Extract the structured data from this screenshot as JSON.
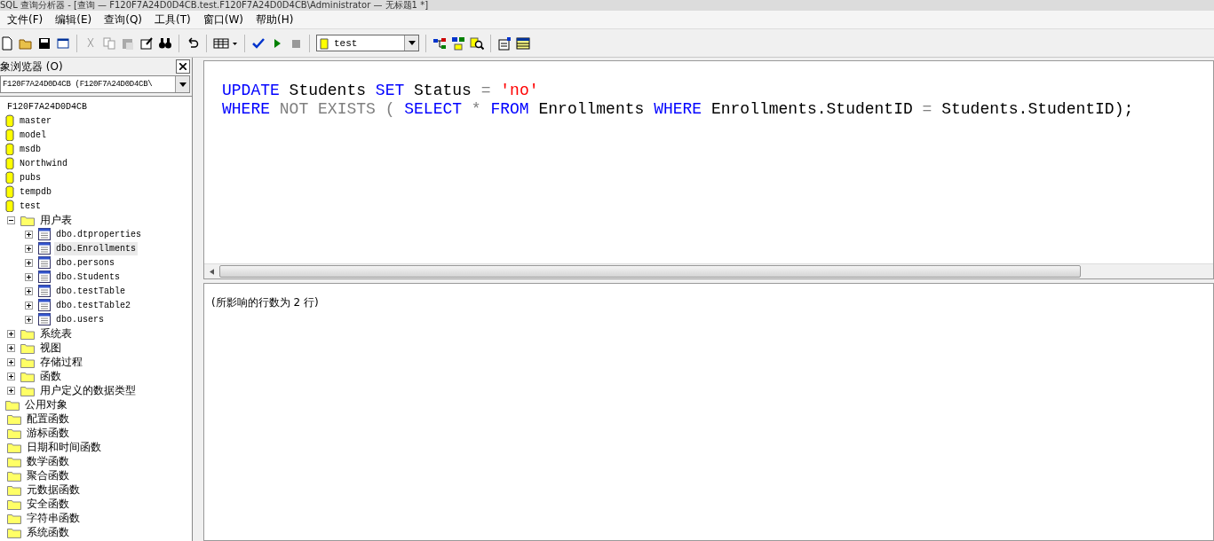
{
  "window": {
    "title": "SQL 查询分析器 - [查询 — F120F7A24D0D4CB.test.F120F7A24D0D4CB\\Administrator — 无标题1 *]"
  },
  "menu": [
    {
      "label": "文件(F)"
    },
    {
      "label": "编辑(E)"
    },
    {
      "label": "查询(Q)"
    },
    {
      "label": "工具(T)"
    },
    {
      "label": "窗口(W)"
    },
    {
      "label": "帮助(H)"
    }
  ],
  "toolbar": {
    "database": "test"
  },
  "object_browser": {
    "title": "象浏览器 (O)",
    "server_select": "F120F7A24D0D4CB (F120F7A24D0D4CB\\",
    "tree": [
      {
        "label": "F120F7A24D0D4CB",
        "children": [
          {
            "label": "master",
            "kind": "database"
          },
          {
            "label": "model",
            "kind": "database"
          },
          {
            "label": "msdb",
            "kind": "database"
          },
          {
            "label": "Northwind",
            "kind": "database"
          },
          {
            "label": "pubs",
            "kind": "database"
          },
          {
            "label": "tempdb",
            "kind": "database"
          },
          {
            "label": "test",
            "kind": "database",
            "children": [
              {
                "label": "用户表",
                "kind": "folder",
                "expanded": true,
                "children": [
                  {
                    "label": "dbo.dtproperties",
                    "kind": "table",
                    "expanded": false,
                    "selected": false
                  },
                  {
                    "label": "dbo.Enrollments",
                    "kind": "table",
                    "expanded": false,
                    "selected": true
                  },
                  {
                    "label": "dbo.persons",
                    "kind": "table",
                    "expanded": false,
                    "selected": false
                  },
                  {
                    "label": "dbo.Students",
                    "kind": "table",
                    "expanded": false,
                    "selected": false
                  },
                  {
                    "label": "dbo.testTable",
                    "kind": "table",
                    "expanded": false,
                    "selected": false
                  },
                  {
                    "label": "dbo.testTable2",
                    "kind": "table",
                    "expanded": false,
                    "selected": false
                  },
                  {
                    "label": "dbo.users",
                    "kind": "table",
                    "expanded": false,
                    "selected": false
                  }
                ]
              },
              {
                "label": "系统表",
                "kind": "folder",
                "expanded": false
              },
              {
                "label": "视图",
                "kind": "folder",
                "expanded": false
              },
              {
                "label": "存储过程",
                "kind": "folder",
                "expanded": false
              },
              {
                "label": "函数",
                "kind": "folder",
                "expanded": false
              },
              {
                "label": "用户定义的数据类型",
                "kind": "folder",
                "expanded": false
              }
            ]
          },
          {
            "label": "公用对象",
            "kind": "folder",
            "children": [
              {
                "label": "配置函数",
                "kind": "folder"
              },
              {
                "label": "游标函数",
                "kind": "folder"
              },
              {
                "label": "日期和时间函数",
                "kind": "folder"
              },
              {
                "label": "数学函数",
                "kind": "folder"
              },
              {
                "label": "聚合函数",
                "kind": "folder"
              },
              {
                "label": "元数据函数",
                "kind": "folder"
              },
              {
                "label": "安全函数",
                "kind": "folder"
              },
              {
                "label": "字符串函数",
                "kind": "folder"
              },
              {
                "label": "系统函数",
                "kind": "folder"
              }
            ]
          }
        ]
      }
    ]
  },
  "editor": {
    "lines": [
      [
        {
          "text": "UPDATE",
          "kind": "keyword"
        },
        {
          "text": " Students ",
          "kind": "plain"
        },
        {
          "text": "SET",
          "kind": "keyword"
        },
        {
          "text": " Status ",
          "kind": "plain"
        },
        {
          "text": "=",
          "kind": "operator"
        },
        {
          "text": " 'no'",
          "kind": "string"
        }
      ],
      [
        {
          "text": "WHERE",
          "kind": "keyword"
        },
        {
          "text": " NOT EXISTS ( ",
          "kind": "operator"
        },
        {
          "text": "SELECT",
          "kind": "keyword"
        },
        {
          "text": " * ",
          "kind": "operator"
        },
        {
          "text": "FROM",
          "kind": "keyword"
        },
        {
          "text": " Enrollments ",
          "kind": "plain"
        },
        {
          "text": "WHERE",
          "kind": "keyword"
        },
        {
          "text": " Enrollments.StudentID ",
          "kind": "plain"
        },
        {
          "text": "=",
          "kind": "operator"
        },
        {
          "text": " Students.StudentID);",
          "kind": "plain"
        }
      ]
    ]
  },
  "results": {
    "message": "(所影响的行数为 2 行)"
  }
}
